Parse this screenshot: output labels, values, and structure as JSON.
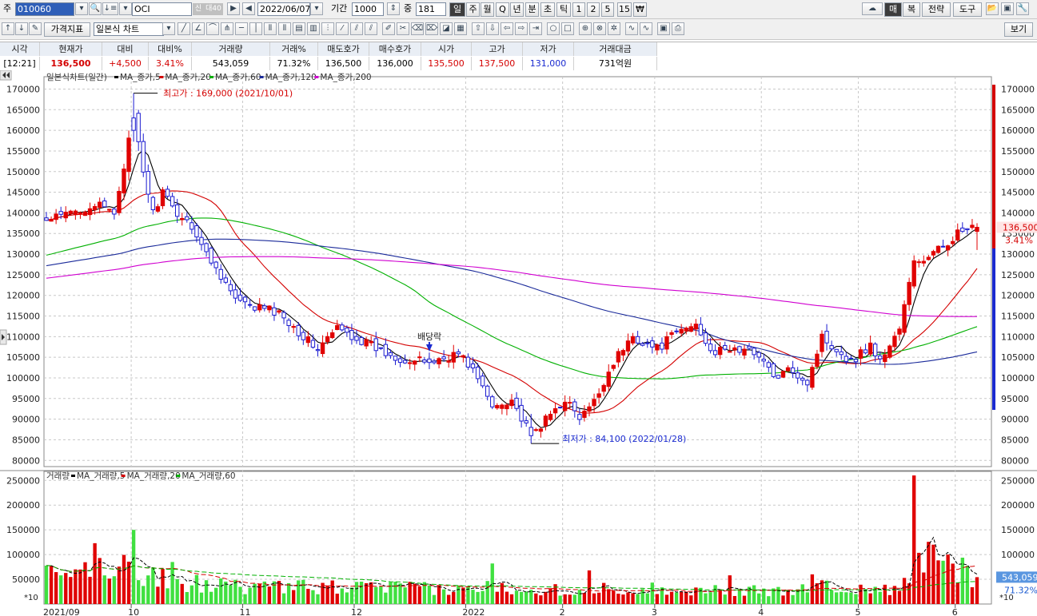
{
  "toolbar": {
    "market_label": "주",
    "code_value": "010060",
    "stock_name": "OCI",
    "badge_credit": "신",
    "badge_loan": "대40",
    "date_value": "2022/06/07",
    "period_label": "기간",
    "period_value": "1000",
    "count_label": "중",
    "count_value": "181",
    "intervals": [
      "일",
      "주",
      "월",
      "Q",
      "년",
      "분",
      "초",
      "틱",
      "1",
      "2",
      "5",
      "15",
      "₩"
    ],
    "right_buttons": [
      "매",
      "복",
      "전략",
      "도구"
    ],
    "view_label": "보기",
    "indicator_label": "가격지표",
    "chart_type_value": "일본식 차트"
  },
  "quote": {
    "headers": [
      "시각",
      "현재가",
      "대비",
      "대비%",
      "거래량",
      "거래%",
      "매도호가",
      "매수호가",
      "시가",
      "고가",
      "저가",
      "거래대금"
    ],
    "values": [
      "[12:21]",
      "136,500",
      "+4,500",
      "3.41%",
      "543,059",
      "71.32%",
      "136,500",
      "136,000",
      "135,500",
      "137,500",
      "131,000",
      "731억원"
    ]
  },
  "chart": {
    "legend_title": "일본식차트(일간)",
    "ma_legend": [
      {
        "label": "MA_종가,5",
        "color": "#000000"
      },
      {
        "label": "MA_종가,20",
        "color": "#d40000"
      },
      {
        "label": "MA_종가,60",
        "color": "#00b000"
      },
      {
        "label": "MA_종가,120",
        "color": "#1a2a9a"
      },
      {
        "label": "MA_종가,200",
        "color": "#d000d0"
      }
    ],
    "vol_legend_title": "거래량",
    "vol_ma_legend": [
      {
        "label": "MA_거래량,5",
        "color": "#000000"
      },
      {
        "label": "MA_거래량,20",
        "color": "#d40000"
      },
      {
        "label": "MA_거래량,60",
        "color": "#00b000"
      }
    ],
    "high_annotation": "최고가 : 169,000 (2021/10/01)",
    "low_annotation": "최저가 : 84,100 (2022/01/28)",
    "dividend_label": "배당락",
    "price_ticks": [
      "170000",
      "165000",
      "160000",
      "155000",
      "150000",
      "145000",
      "140000",
      "135000",
      "130000",
      "125000",
      "120000",
      "115000",
      "110000",
      "105000",
      "100000",
      "95000",
      "90000",
      "85000",
      "80000"
    ],
    "volume_ticks": [
      "250000",
      "200000",
      "150000",
      "100000",
      "50000"
    ],
    "volume_unit": "*10",
    "x_labels": [
      "2021/09",
      "10",
      "11",
      "12",
      "2022",
      "2",
      "3",
      "4",
      "5",
      "6"
    ],
    "current_price_label": "136,500",
    "current_change_label": "3.41%",
    "current_volume_label": "543,059",
    "current_volume_pct_label": "71.32%",
    "colors": {
      "up": "#e00000",
      "down": "#1a1ad0",
      "vol_up": "#e00000",
      "vol_down": "#40e040"
    }
  },
  "chart_data": {
    "type": "candlestick",
    "price_ylim": [
      78500,
      173000
    ],
    "volume_ylim": [
      0,
      265000
    ],
    "x_month_labels": [
      "2021/09",
      "10",
      "11",
      "12",
      "2022",
      "2",
      "3",
      "4",
      "5",
      "6"
    ],
    "month_start_index": [
      0,
      18,
      41,
      64,
      87,
      107,
      126,
      148,
      168,
      188
    ],
    "n_candles": 193,
    "knots_close": [
      [
        0,
        138000
      ],
      [
        10,
        142000
      ],
      [
        14,
        140000
      ],
      [
        18,
        163000
      ],
      [
        20,
        150000
      ],
      [
        22,
        140000
      ],
      [
        24,
        145000
      ],
      [
        26,
        141000
      ],
      [
        30,
        137000
      ],
      [
        33,
        130000
      ],
      [
        36,
        125000
      ],
      [
        39,
        119000
      ],
      [
        42,
        117000
      ],
      [
        45,
        117000
      ],
      [
        49,
        115000
      ],
      [
        53,
        110000
      ],
      [
        56,
        107000
      ],
      [
        60,
        112000
      ],
      [
        65,
        109000
      ],
      [
        70,
        106000
      ],
      [
        75,
        104000
      ],
      [
        80,
        104000
      ],
      [
        85,
        106000
      ],
      [
        88,
        102000
      ],
      [
        92,
        93000
      ],
      [
        96,
        95000
      ],
      [
        98,
        90000
      ],
      [
        100,
        86000
      ],
      [
        104,
        91000
      ],
      [
        107,
        95000
      ],
      [
        110,
        90000
      ],
      [
        113,
        94000
      ],
      [
        117,
        104000
      ],
      [
        121,
        110000
      ],
      [
        126,
        107000
      ],
      [
        130,
        111000
      ],
      [
        134,
        113000
      ],
      [
        136,
        109000
      ],
      [
        138,
        106000
      ],
      [
        141,
        107000
      ],
      [
        147,
        106000
      ],
      [
        150,
        100000
      ],
      [
        154,
        102000
      ],
      [
        157,
        99000
      ],
      [
        160,
        110000
      ],
      [
        163,
        107000
      ],
      [
        166,
        104000
      ],
      [
        170,
        108000
      ],
      [
        172,
        104000
      ],
      [
        174,
        108000
      ],
      [
        176,
        112000
      ],
      [
        179,
        128000
      ],
      [
        182,
        129000
      ],
      [
        185,
        132000
      ],
      [
        188,
        135000
      ],
      [
        192,
        136500
      ]
    ],
    "knots_vol": [
      [
        0,
        55000
      ],
      [
        5,
        60000
      ],
      [
        10,
        70000
      ],
      [
        16,
        75000
      ],
      [
        20,
        65000
      ],
      [
        26,
        45000
      ],
      [
        35,
        38000
      ],
      [
        45,
        32000
      ],
      [
        55,
        35000
      ],
      [
        65,
        33000
      ],
      [
        75,
        32000
      ],
      [
        85,
        28000
      ],
      [
        92,
        35000
      ],
      [
        100,
        32000
      ],
      [
        110,
        28000
      ],
      [
        120,
        32000
      ],
      [
        130,
        30000
      ],
      [
        140,
        28000
      ],
      [
        150,
        25000
      ],
      [
        160,
        35000
      ],
      [
        170,
        30000
      ],
      [
        176,
        25000
      ],
      [
        180,
        80000
      ],
      [
        184,
        110000
      ],
      [
        188,
        70000
      ],
      [
        192,
        54306
      ]
    ],
    "vol_spikes": [
      [
        10,
        123000
      ],
      [
        18,
        150000
      ],
      [
        26,
        85000
      ],
      [
        92,
        82000
      ],
      [
        112,
        68000
      ],
      [
        141,
        58000
      ],
      [
        158,
        60000
      ],
      [
        179,
        260000
      ],
      [
        183,
        120000
      ],
      [
        186,
        100000
      ]
    ],
    "high_point": {
      "index": 18,
      "value": 169000,
      "date": "2021/10/01"
    },
    "low_point": {
      "index": 100,
      "value": 84100,
      "date": "2022/01/28"
    },
    "dividend_index": 79,
    "last": {
      "open": 135500,
      "high": 137500,
      "low": 131000,
      "close": 136500,
      "volume": 543059
    }
  }
}
